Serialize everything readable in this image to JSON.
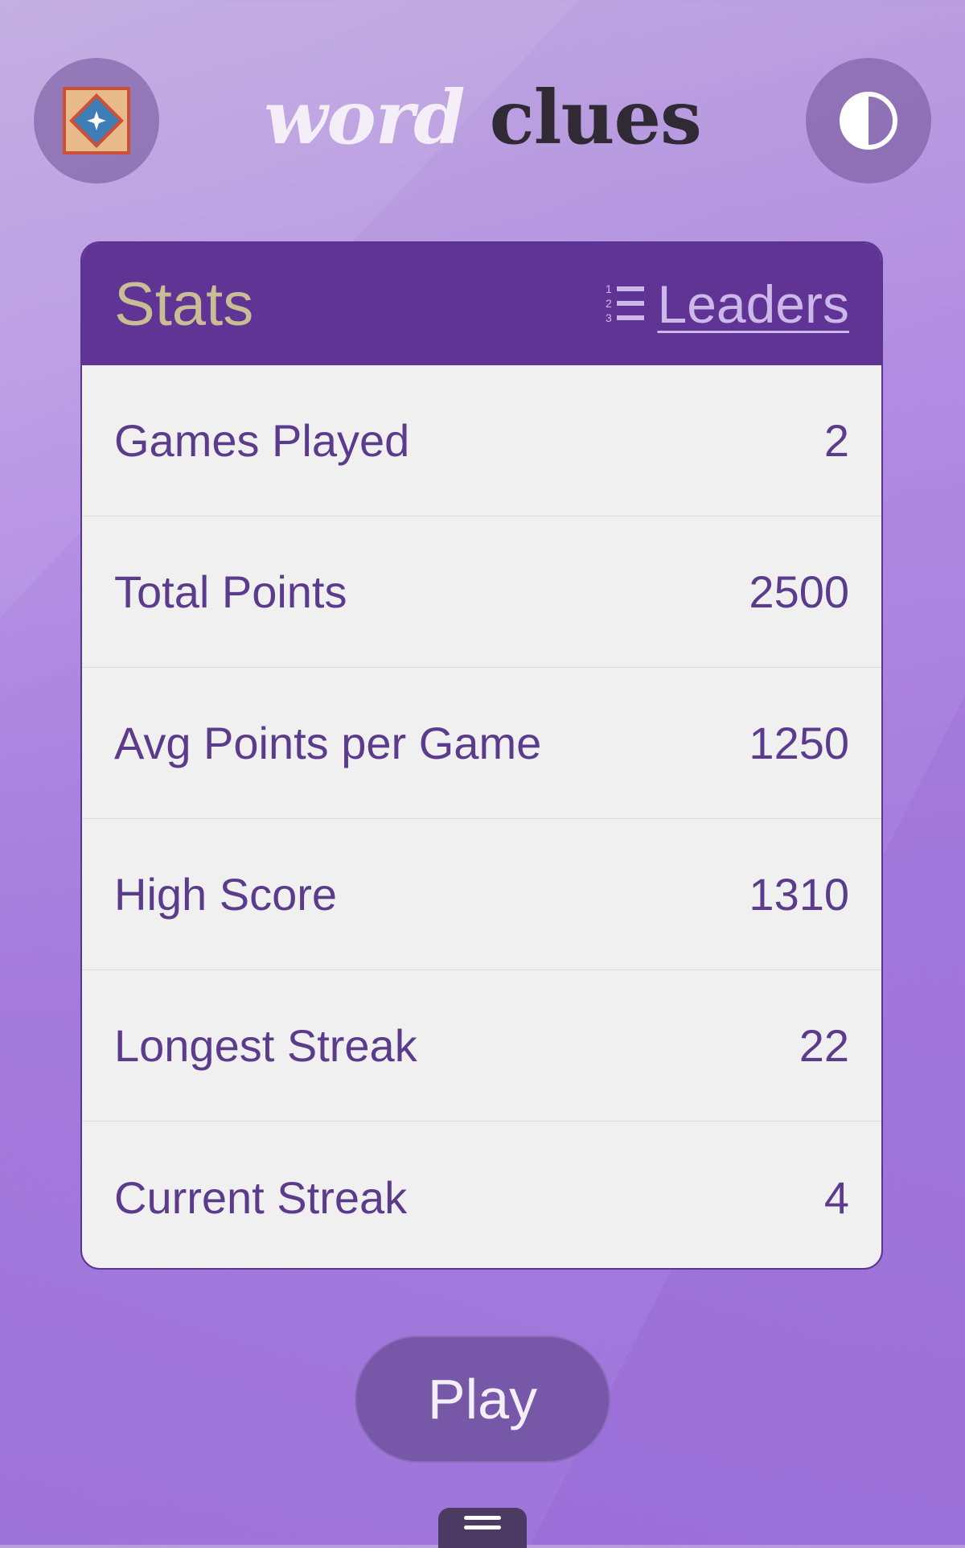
{
  "app": {
    "title_word1": "word",
    "title_word2": "clues"
  },
  "header": {
    "logo_icon": "diamond-badge-icon",
    "theme_icon": "half-circle-contrast-icon"
  },
  "stats": {
    "title": "Stats",
    "leaders_label": "Leaders",
    "leaders_icon": "numbered-list-icon",
    "rows": [
      {
        "label": "Games Played",
        "value": "2"
      },
      {
        "label": "Total Points",
        "value": "2500"
      },
      {
        "label": "Avg Points per Game",
        "value": "1250"
      },
      {
        "label": "High Score",
        "value": "1310"
      },
      {
        "label": "Longest Streak",
        "value": "22"
      },
      {
        "label": "Current Streak",
        "value": "4"
      }
    ]
  },
  "actions": {
    "play_label": "Play",
    "menu_icon": "hamburger-menu-icon"
  },
  "colors": {
    "card_header": "#5f3495",
    "stat_text": "#5b3b8c",
    "stats_title": "#c8bd94"
  }
}
